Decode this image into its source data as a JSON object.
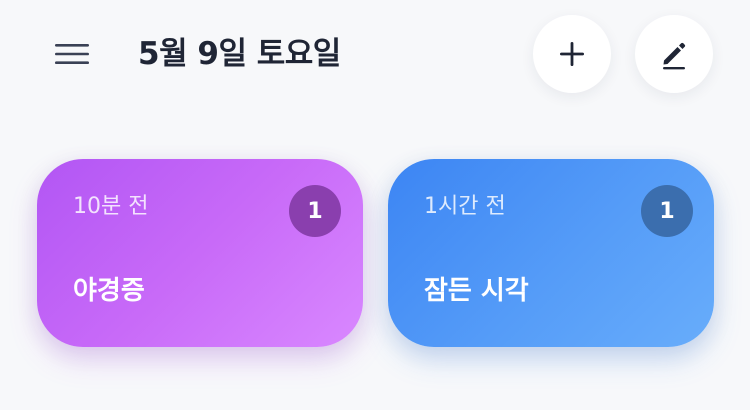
{
  "header": {
    "title": "5월 9일 토요일",
    "menu_icon": "hamburger-menu-icon",
    "add_icon": "plus-icon",
    "edit_icon": "pencil-icon"
  },
  "cards": [
    {
      "time": "10분 전",
      "title": "야경증",
      "count": "1",
      "color": "#c46af8"
    },
    {
      "time": "1시간 전",
      "title": "잠든 시각",
      "count": "1",
      "color": "#4f95f6"
    }
  ]
}
